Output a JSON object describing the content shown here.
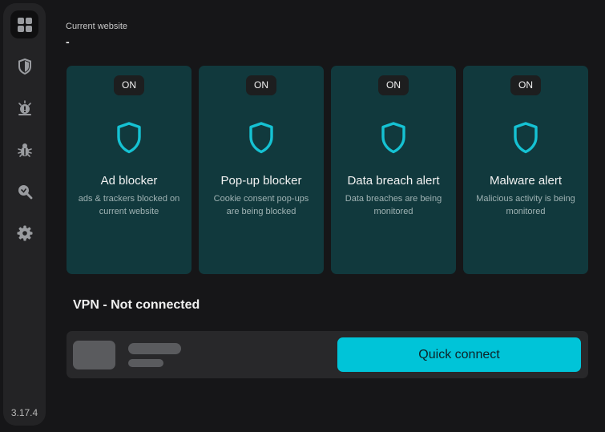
{
  "sidebar": {
    "items": [
      {
        "icon": "dashboard-icon",
        "active": true
      },
      {
        "icon": "shield-icon",
        "active": false
      },
      {
        "icon": "alert-icon",
        "active": false
      },
      {
        "icon": "bug-icon",
        "active": false
      },
      {
        "icon": "search-icon",
        "active": false
      },
      {
        "icon": "gear-icon",
        "active": false
      }
    ],
    "version": "3.17.4"
  },
  "current_website": {
    "label": "Current website",
    "value": "-"
  },
  "cards": [
    {
      "status": "ON",
      "title": "Ad blocker",
      "description": "ads & trackers blocked on current website"
    },
    {
      "status": "ON",
      "title": "Pop-up blocker",
      "description": "Cookie consent pop-ups are being blocked"
    },
    {
      "status": "ON",
      "title": "Data breach alert",
      "description": "Data breaches are being monitored"
    },
    {
      "status": "ON",
      "title": "Malware alert",
      "description": "Malicious activity is being monitored"
    }
  ],
  "vpn": {
    "title": "VPN - Not connected",
    "button_label": "Quick connect"
  },
  "colors": {
    "accent": "#00c4d8",
    "card_bg": "#11393d",
    "page_bg": "#161618"
  }
}
